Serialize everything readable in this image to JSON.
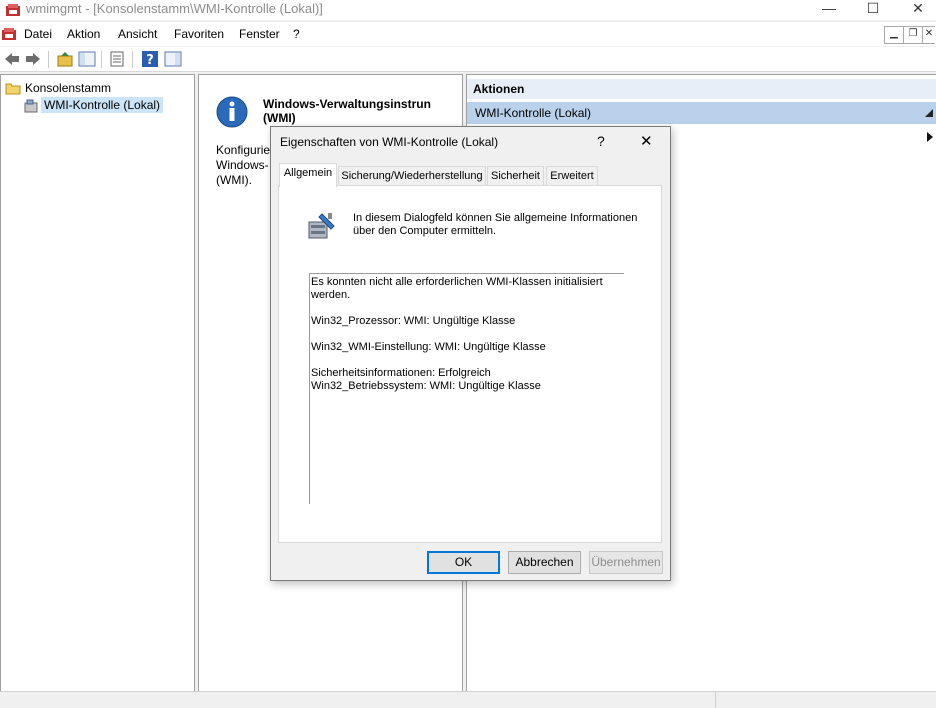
{
  "window": {
    "title": "wmimgmt - [Konsolenstamm\\WMI-Kontrolle (Lokal)]",
    "minimize": "—",
    "maximize": "☐",
    "close": "✕"
  },
  "menu": {
    "items": [
      "Datei",
      "Aktion",
      "Ansicht",
      "Favoriten",
      "Fenster",
      "?"
    ]
  },
  "tree": {
    "root": "Konsolenstamm",
    "child": "WMI-Kontrolle (Lokal)"
  },
  "middle": {
    "heading_line1": "Windows-Verwaltungsinstrun",
    "heading_line2": "(WMI)",
    "desc_line1": "Konfigurie",
    "desc_line2": "Windows-",
    "desc_line3": "(WMI)."
  },
  "actions": {
    "header": "Aktionen",
    "selected": "WMI-Kontrolle (Lokal)"
  },
  "dialog": {
    "title": "Eigenschaften von WMI-Kontrolle (Lokal)",
    "help": "?",
    "close": "✕",
    "tabs": [
      "Allgemein",
      "Sicherung/Wiederherstellung",
      "Sicherheit",
      "Erweitert"
    ],
    "intro_line1": "In diesem Dialogfeld können Sie allgemeine Informationen",
    "intro_line2": "über den Computer ermitteln.",
    "messages": {
      "m1a": "Es konnten nicht alle erforderlichen WMI-Klassen initialisiert",
      "m1b": "werden.",
      "m2": "Win32_Prozessor: WMI: Ungültige Klasse",
      "m3": "Win32_WMI-Einstellung: WMI: Ungültige Klasse",
      "m4": "Sicherheitsinformationen: Erfolgreich",
      "m5": "Win32_Betriebssystem: WMI: Ungültige Klasse"
    },
    "buttons": {
      "ok": "OK",
      "cancel": "Abbrechen",
      "apply": "Übernehmen"
    }
  },
  "colors": {
    "selection": "#cce4f7",
    "actions_header": "#e8eef7",
    "actions_selected": "#b9d1ea",
    "ok_border": "#0078d7"
  }
}
